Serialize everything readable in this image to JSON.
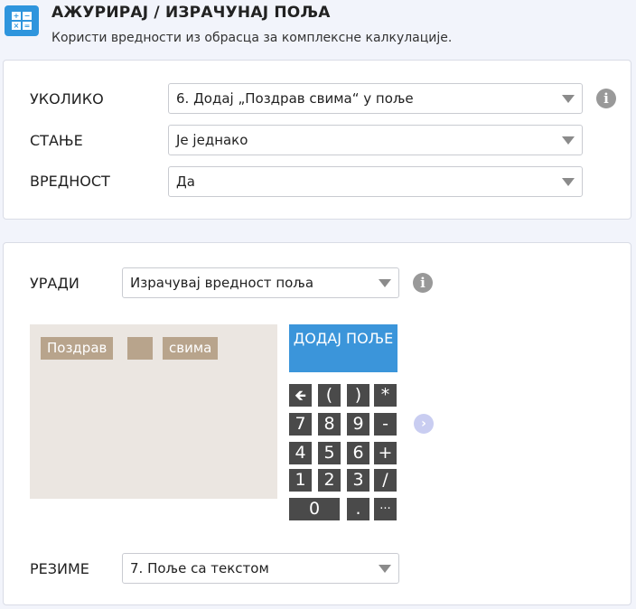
{
  "header": {
    "title": "АЖУРИРАЈ / ИЗРАЧУНАЈ ПОЉА",
    "subtitle": "Користи вредности из обрасца за комплексне калкулације.",
    "icon": "calculator-icon",
    "icon_glyphs": [
      "+",
      "−",
      "×",
      "="
    ]
  },
  "condition": {
    "if_label": "УКОЛИКО",
    "if_value": "6. Додај „Поздрав свима“ у поље",
    "state_label": "СТАЊЕ",
    "state_value": "Је једнако",
    "value_label": "ВРЕДНОСТ",
    "value_value": "Да",
    "info_glyph": "i"
  },
  "action": {
    "do_label": "УРАДИ",
    "do_value": "Израчувај вредност поља",
    "info_glyph": "i",
    "formula_tokens": [
      "Поздрав",
      "",
      "свима"
    ],
    "add_field_label": "ДОДАЈ ПОЉЕ",
    "keypad": {
      "row1": [
        "🡸",
        "(",
        ")",
        "*"
      ],
      "row2": [
        "7",
        "8",
        "9",
        "-"
      ],
      "row3": [
        "4",
        "5",
        "6",
        "+"
      ],
      "row4": [
        "1",
        "2",
        "3",
        "/"
      ],
      "row5": [
        "0",
        ".",
        "···"
      ]
    },
    "next_glyph": "›",
    "result_label": "РЕЗИМЕ",
    "result_value": "7. Поље са текстом"
  },
  "colors": {
    "accent": "#3b95da",
    "token": "#b8a48c",
    "formula_bg": "#ebe6e1",
    "key_bg": "#4a4a4a"
  }
}
